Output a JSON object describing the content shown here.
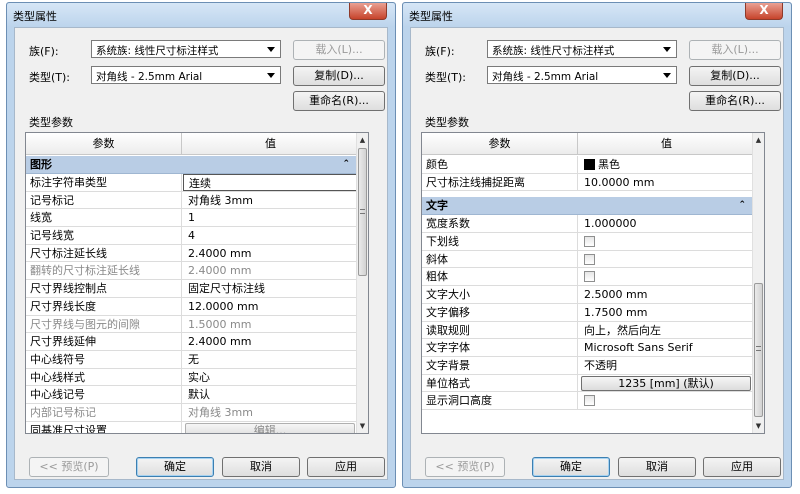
{
  "left": {
    "title": "类型属性",
    "close": "X",
    "family_label": "族(F):",
    "family_value": "系统族: 线性尺寸标注样式",
    "type_label": "类型(T):",
    "type_value": "对角线 - 2.5mm Arial",
    "load_btn": "载入(L)...",
    "dup_btn": "复制(D)...",
    "rename_btn": "重命名(R)...",
    "params_label": "类型参数",
    "col_param": "参数",
    "col_value": "值",
    "group_title": "图形",
    "group_chevron": "⌃",
    "rows": [
      {
        "param": "标注字符串类型",
        "value": "连续",
        "style": "edit"
      },
      {
        "param": "记号标记",
        "value": "对角线 3mm",
        "style": ""
      },
      {
        "param": "线宽",
        "value": "1",
        "style": ""
      },
      {
        "param": "记号线宽",
        "value": "4",
        "style": ""
      },
      {
        "param": "尺寸标注延长线",
        "value": "2.4000 mm",
        "style": ""
      },
      {
        "param": "翻转的尺寸标注延长线",
        "value": "2.4000 mm",
        "style": "gray"
      },
      {
        "param": "尺寸界线控制点",
        "value": "固定尺寸标注线",
        "style": ""
      },
      {
        "param": "尺寸界线长度",
        "value": "12.0000 mm",
        "style": ""
      },
      {
        "param": "尺寸界线与图元的间隙",
        "value": "1.5000 mm",
        "style": "gray"
      },
      {
        "param": "尺寸界线延伸",
        "value": "2.4000 mm",
        "style": ""
      },
      {
        "param": "中心线符号",
        "value": "无",
        "style": ""
      },
      {
        "param": "中心线样式",
        "value": "实心",
        "style": ""
      },
      {
        "param": "中心线记号",
        "value": "默认",
        "style": ""
      },
      {
        "param": "内部记号标记",
        "value": "对角线 3mm",
        "style": "gray"
      },
      {
        "param": "同基准尺寸设置",
        "value": "编辑...",
        "style": "btn-gray"
      }
    ],
    "preview_btn": "<< 预览(P)",
    "ok_btn": "确定",
    "cancel_btn": "取消",
    "apply_btn": "应用"
  },
  "right": {
    "title": "类型属性",
    "close": "X",
    "family_label": "族(F):",
    "family_value": "系统族: 线性尺寸标注样式",
    "type_label": "类型(T):",
    "type_value": "对角线 - 2.5mm Arial",
    "load_btn": "载入(L)...",
    "dup_btn": "复制(D)...",
    "rename_btn": "重命名(R)...",
    "params_label": "类型参数",
    "col_param": "参数",
    "col_value": "值",
    "top_rows": [
      {
        "param": "颜色",
        "value": "黑色",
        "style": "swatch"
      },
      {
        "param": "尺寸标注线捕捉距离",
        "value": "10.0000 mm",
        "style": ""
      }
    ],
    "group_title": "文字",
    "group_chevron": "⌃",
    "rows": [
      {
        "param": "宽度系数",
        "value": "1.000000",
        "style": ""
      },
      {
        "param": "下划线",
        "value": "",
        "style": "check"
      },
      {
        "param": "斜体",
        "value": "",
        "style": "check"
      },
      {
        "param": "粗体",
        "value": "",
        "style": "check"
      },
      {
        "param": "文字大小",
        "value": "2.5000 mm",
        "style": ""
      },
      {
        "param": "文字偏移",
        "value": "1.7500 mm",
        "style": ""
      },
      {
        "param": "读取规则",
        "value": "向上，然后向左",
        "style": ""
      },
      {
        "param": "文字字体",
        "value": "Microsoft Sans Serif",
        "style": ""
      },
      {
        "param": "文字背景",
        "value": "不透明",
        "style": ""
      },
      {
        "param": "单位格式",
        "value": "1235 [mm] (默认)",
        "style": "btn"
      },
      {
        "param": "显示洞口高度",
        "value": "",
        "style": "check"
      }
    ],
    "preview_btn": "<< 预览(P)",
    "ok_btn": "确定",
    "cancel_btn": "取消",
    "apply_btn": "应用"
  }
}
